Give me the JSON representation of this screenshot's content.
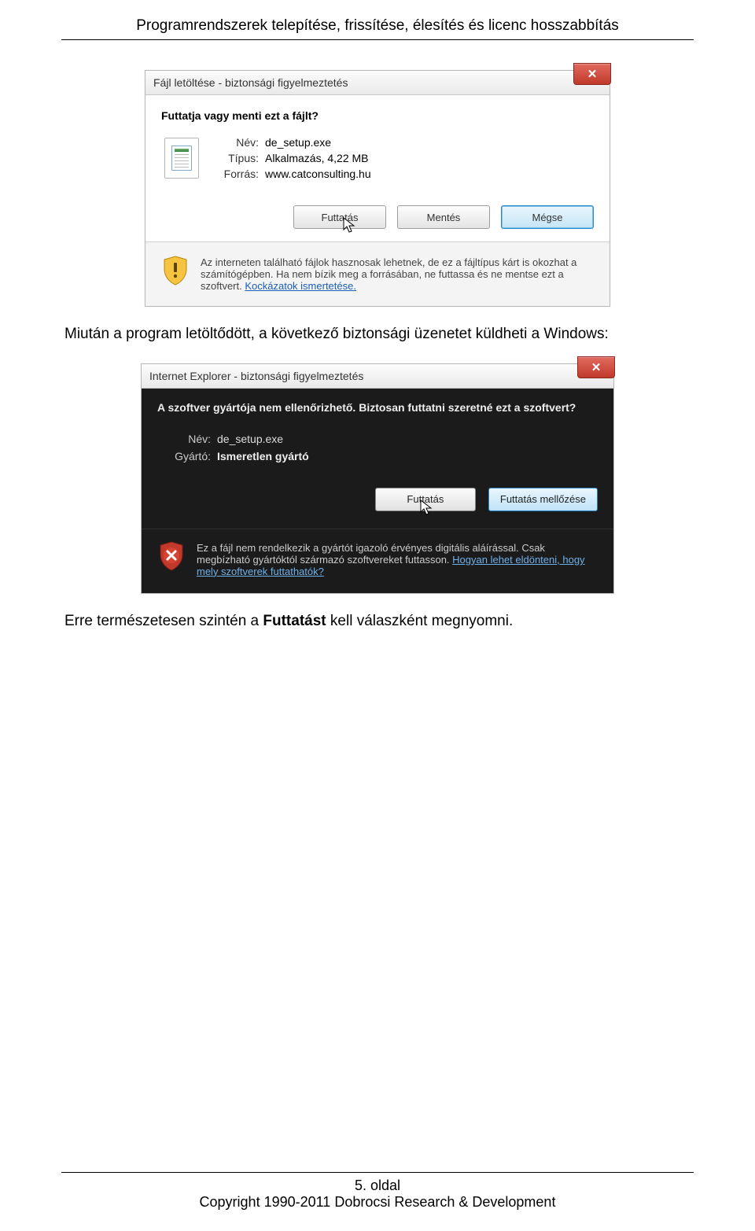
{
  "header": {
    "title": "Programrendszerek telepítése, frissítése, élesítés és licenc hosszabbítás"
  },
  "dialog1": {
    "title": "Fájl letöltése - biztonsági figyelmeztetés",
    "prompt": "Futtatja vagy menti ezt a fájlt?",
    "name_label": "Név:",
    "name_value": "de_setup.exe",
    "type_label": "Típus:",
    "type_value": "Alkalmazás, 4,22 MB",
    "source_label": "Forrás:",
    "source_value": "www.catconsulting.hu",
    "run": "Futtatás",
    "save": "Mentés",
    "cancel": "Mégse",
    "warning": "Az interneten található fájlok hasznosak lehetnek, de ez a fájltípus kárt is okozhat a számítógépben. Ha nem bízik meg a forrásában, ne futtassa és ne mentse ezt a szoftvert. ",
    "risk_link": "Kockázatok ismertetése."
  },
  "text1": "Miután a program letöltődött, a következő biztonsági üzenetet küldheti a Windows:",
  "dialog2": {
    "title": "Internet Explorer - biztonsági figyelmeztetés",
    "prompt": "A szoftver gyártója nem ellenőrizhető. Biztosan futtatni szeretné ezt a szoftvert?",
    "name_label": "Név:",
    "name_value": "de_setup.exe",
    "vendor_label": "Gyártó:",
    "vendor_value": "Ismeretlen gyártó",
    "run": "Futtatás",
    "skip": "Futtatás mellőzése",
    "warning": "Ez a fájl nem rendelkezik a gyártót igazoló érvényes digitális aláírással. Csak megbízható gyártóktól származó szoftvereket futtasson. ",
    "how_link": "Hogyan lehet eldönteni, hogy mely szoftverek futtathatók?"
  },
  "text2_pre": "Erre természetesen szintén a ",
  "text2_bold": "Futtatást",
  "text2_post": " kell válaszként megnyomni.",
  "footer": {
    "page": "5. oldal",
    "copyright": "Copyright 1990-2011 Dobrocsi Research & Development"
  }
}
